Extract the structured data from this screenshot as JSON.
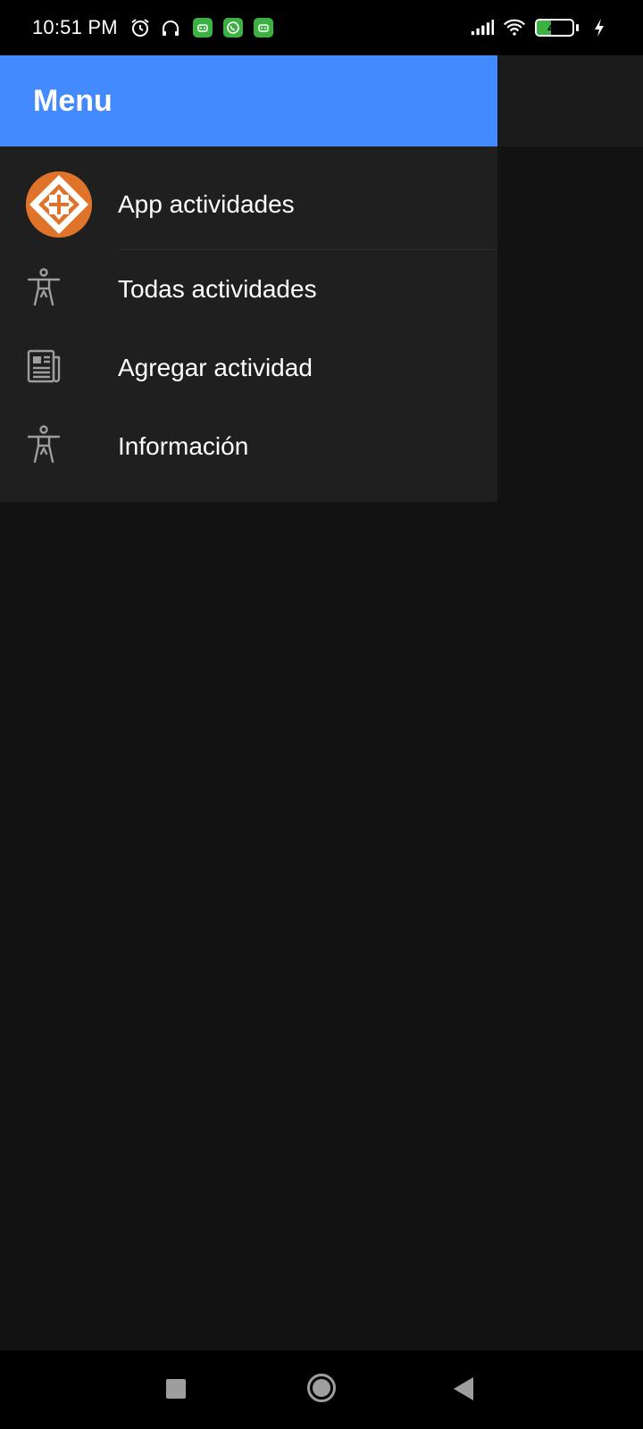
{
  "status_bar": {
    "time": "10:51 PM",
    "battery_level": "40",
    "battery_fraction": 0.4,
    "icons": [
      "alarm-icon",
      "headphones-icon",
      "app-notification-icon",
      "whatsapp-icon",
      "app-notification-icon",
      "signal-icon",
      "wifi-icon",
      "battery-icon",
      "charging-icon"
    ]
  },
  "drawer": {
    "title": "Menu",
    "header_color": "#448aff",
    "items": [
      {
        "label": "App actividades",
        "icon": "app-logo-icon"
      },
      {
        "label": "Todas actividades",
        "icon": "accessibility-icon"
      },
      {
        "label": "Agregar actividad",
        "icon": "newspaper-icon"
      },
      {
        "label": "Información",
        "icon": "accessibility-icon"
      }
    ]
  },
  "nav_bar": {
    "buttons": [
      "recents-button",
      "home-button",
      "back-button"
    ]
  }
}
